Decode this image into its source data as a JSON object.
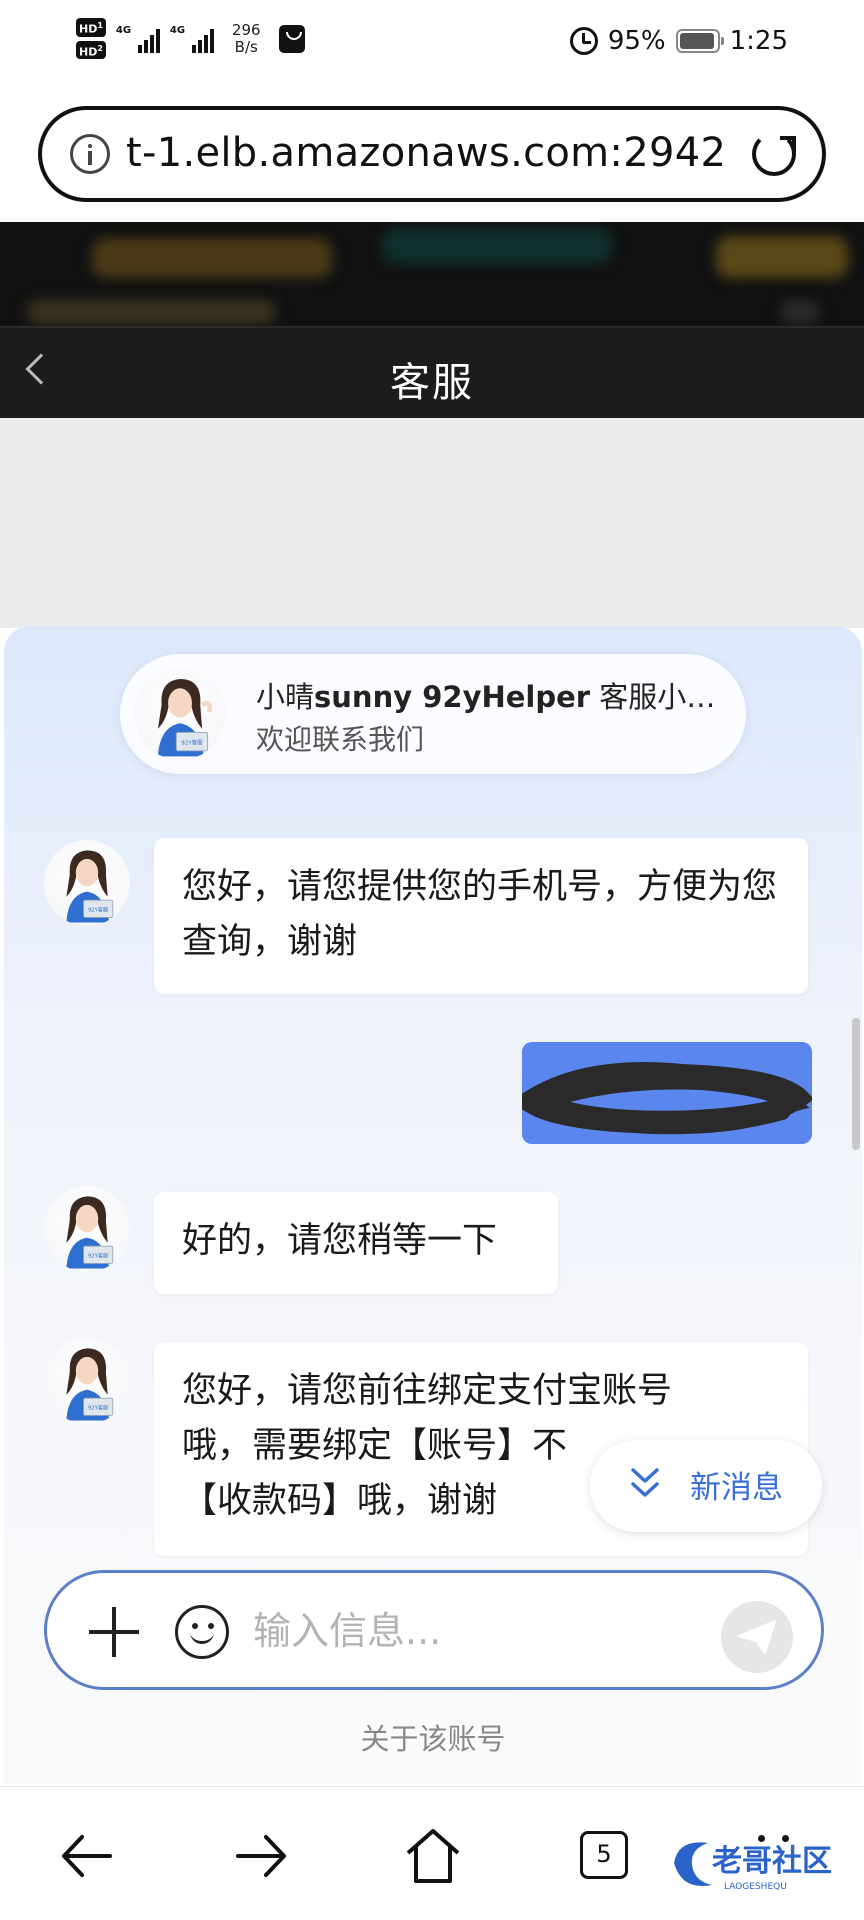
{
  "status_bar": {
    "hd1": "HD",
    "hd1_sub": "1",
    "hd2": "HD",
    "hd2_sub": "2",
    "network1": "4G",
    "network2": "4G",
    "speed_value": "296",
    "speed_unit": "B/s",
    "battery": "95%",
    "battery_level": 0.95,
    "time": "1:25",
    "icons": [
      "hd-icon",
      "signal-icon",
      "shopping-bag-icon",
      "alarm-icon",
      "battery-icon"
    ]
  },
  "browser": {
    "url": "t-1.elb.amazonaws.com:2942",
    "icons": [
      "info-icon",
      "reload-icon"
    ]
  },
  "chat": {
    "title": "客服",
    "agent": {
      "name_prefix": "小晴",
      "name_bold": "sunny 92yHelper",
      "name_suffix": " 客服小助...",
      "subtitle": "欢迎联系我们",
      "avatar_badge": "92Y客服"
    },
    "messages": [
      {
        "from": "agent",
        "text": "您好，请您提供您的手机号，方便为您查询，谢谢"
      },
      {
        "from": "user",
        "text": "",
        "redacted": true
      },
      {
        "from": "agent",
        "text": "好的，请您稍等一下"
      },
      {
        "from": "agent",
        "text_visible_1": "您好，请您前往绑定支付宝账号",
        "text_visible_2": "哦，需要绑定【账号】不",
        "text_visible_3": "【收款码】哦，谢谢"
      }
    ],
    "new_message_label": "新消息",
    "input_placeholder": "输入信息...",
    "about_label": "关于该账号"
  },
  "bottom_nav": {
    "tabs_count": "5",
    "icons": [
      "back-arrow-icon",
      "forward-arrow-icon",
      "home-icon",
      "tabs-icon",
      "more-icon"
    ],
    "watermark": "老哥社区",
    "watermark_sub": "LAOGESHEQU"
  },
  "colors": {
    "user_bubble": "#5b86ee",
    "accent_blue": "#3b6fd8",
    "header_dark": "#1c1c1c"
  }
}
